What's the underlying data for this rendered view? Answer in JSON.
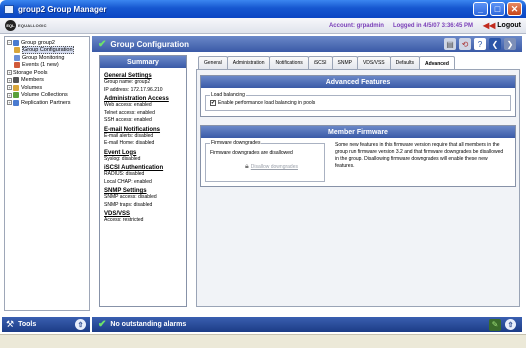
{
  "window": {
    "title": "group2 Group Manager"
  },
  "header": {
    "logo_text": "EQUALLOGIC",
    "account": "Account: grpadmin",
    "logged_in": "Logged in 4/5/07 3:36:45 PM",
    "logout": "Logout"
  },
  "tree": {
    "items": [
      {
        "label": "Group group2",
        "icon": "group-icon",
        "color": "#4a7bd0"
      },
      {
        "label": "Group Configuration",
        "icon": "config-icon",
        "color": "#d9a63a"
      },
      {
        "label": "Group Monitoring",
        "icon": "monitor-icon",
        "color": "#6b8fd6"
      },
      {
        "label": "Events (1 new)",
        "icon": "events-icon",
        "color": "#d05a3a"
      },
      {
        "label": "Storage Pools",
        "icon": "pool-icon",
        "color": "#888888"
      },
      {
        "label": "Members",
        "icon": "members-icon",
        "color": "#555555"
      },
      {
        "label": "Volumes",
        "icon": "volumes-icon",
        "color": "#d9a63a"
      },
      {
        "label": "Volume Collections",
        "icon": "collections-icon",
        "color": "#5aa03a"
      },
      {
        "label": "Replication Partners",
        "icon": "replication-icon",
        "color": "#4a7bd0"
      }
    ]
  },
  "tools": {
    "label": "Tools"
  },
  "main": {
    "title": "Group Configuration"
  },
  "summary": {
    "title": "Summary",
    "sections": [
      {
        "heading": "General Settings",
        "lines": [
          "Group name: group2",
          "IP address: 172.17.96.210"
        ]
      },
      {
        "heading": "Administration Access",
        "lines": [
          "Web access: enabled",
          "Telnet access: enabled",
          "SSH access: enabled"
        ]
      },
      {
        "heading": "E-mail Notifications",
        "lines": [
          "E-mail alerts: disabled",
          "E-mail Home: disabled"
        ]
      },
      {
        "heading": "Event Logs",
        "lines": [
          "Syslog: disabled"
        ]
      },
      {
        "heading": "iSCSI Authentication",
        "lines": [
          "RADIUS: disabled",
          "Local CHAP: enabled"
        ]
      },
      {
        "heading": "SNMP Settings",
        "lines": [
          "SNMP access: disabled",
          "SNMP traps: disabled"
        ]
      },
      {
        "heading": "VDS/VSS",
        "lines": [
          "Access: restricted"
        ]
      }
    ]
  },
  "tabs": [
    "General",
    "Administration",
    "Notifications",
    "iSCSI",
    "SNMP",
    "VDS/VSS",
    "Defaults",
    "Advanced"
  ],
  "active_tab": "Advanced",
  "advanced": {
    "title": "Advanced Features",
    "legend": "Load balancing",
    "checkbox_label": "Enable performance load balancing in pools",
    "checked": true
  },
  "firmware": {
    "title": "Member Firmware",
    "legend": "Firmware downgrades",
    "status": "Firmware downgrades are disallowed",
    "button": "Disallow downgrades",
    "info": "Some new features in this firmware version require that all members in the group run firmware version 3.2 and that firmware downgrades be disallowed in the group. Disallowing firmware downgrades will enable these new features."
  },
  "alarms": {
    "label": "No outstanding alarms"
  }
}
